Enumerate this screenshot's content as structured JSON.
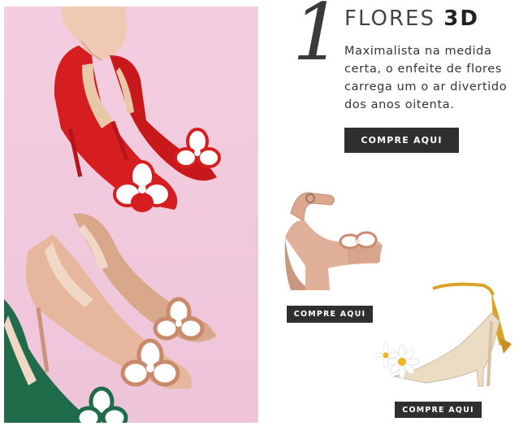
{
  "feature": {
    "number": "1",
    "title_light": "FLORES",
    "title_bold": "3D",
    "description": "Maximalista na medida certa, o enfeite de flores carrega um o ar divertido dos anos oitenta.",
    "cta_label": "COMPRE AQUI"
  },
  "products": [
    {
      "name": "platform-sandal",
      "cta_label": "COMPRE AQUI"
    },
    {
      "name": "daisy-lace-up-sandal",
      "cta_label": "COMPRE AQUI"
    }
  ],
  "colors": {
    "hero_background": "#f2c9dc",
    "button": "#2f2f2f",
    "heading": "#333333"
  }
}
